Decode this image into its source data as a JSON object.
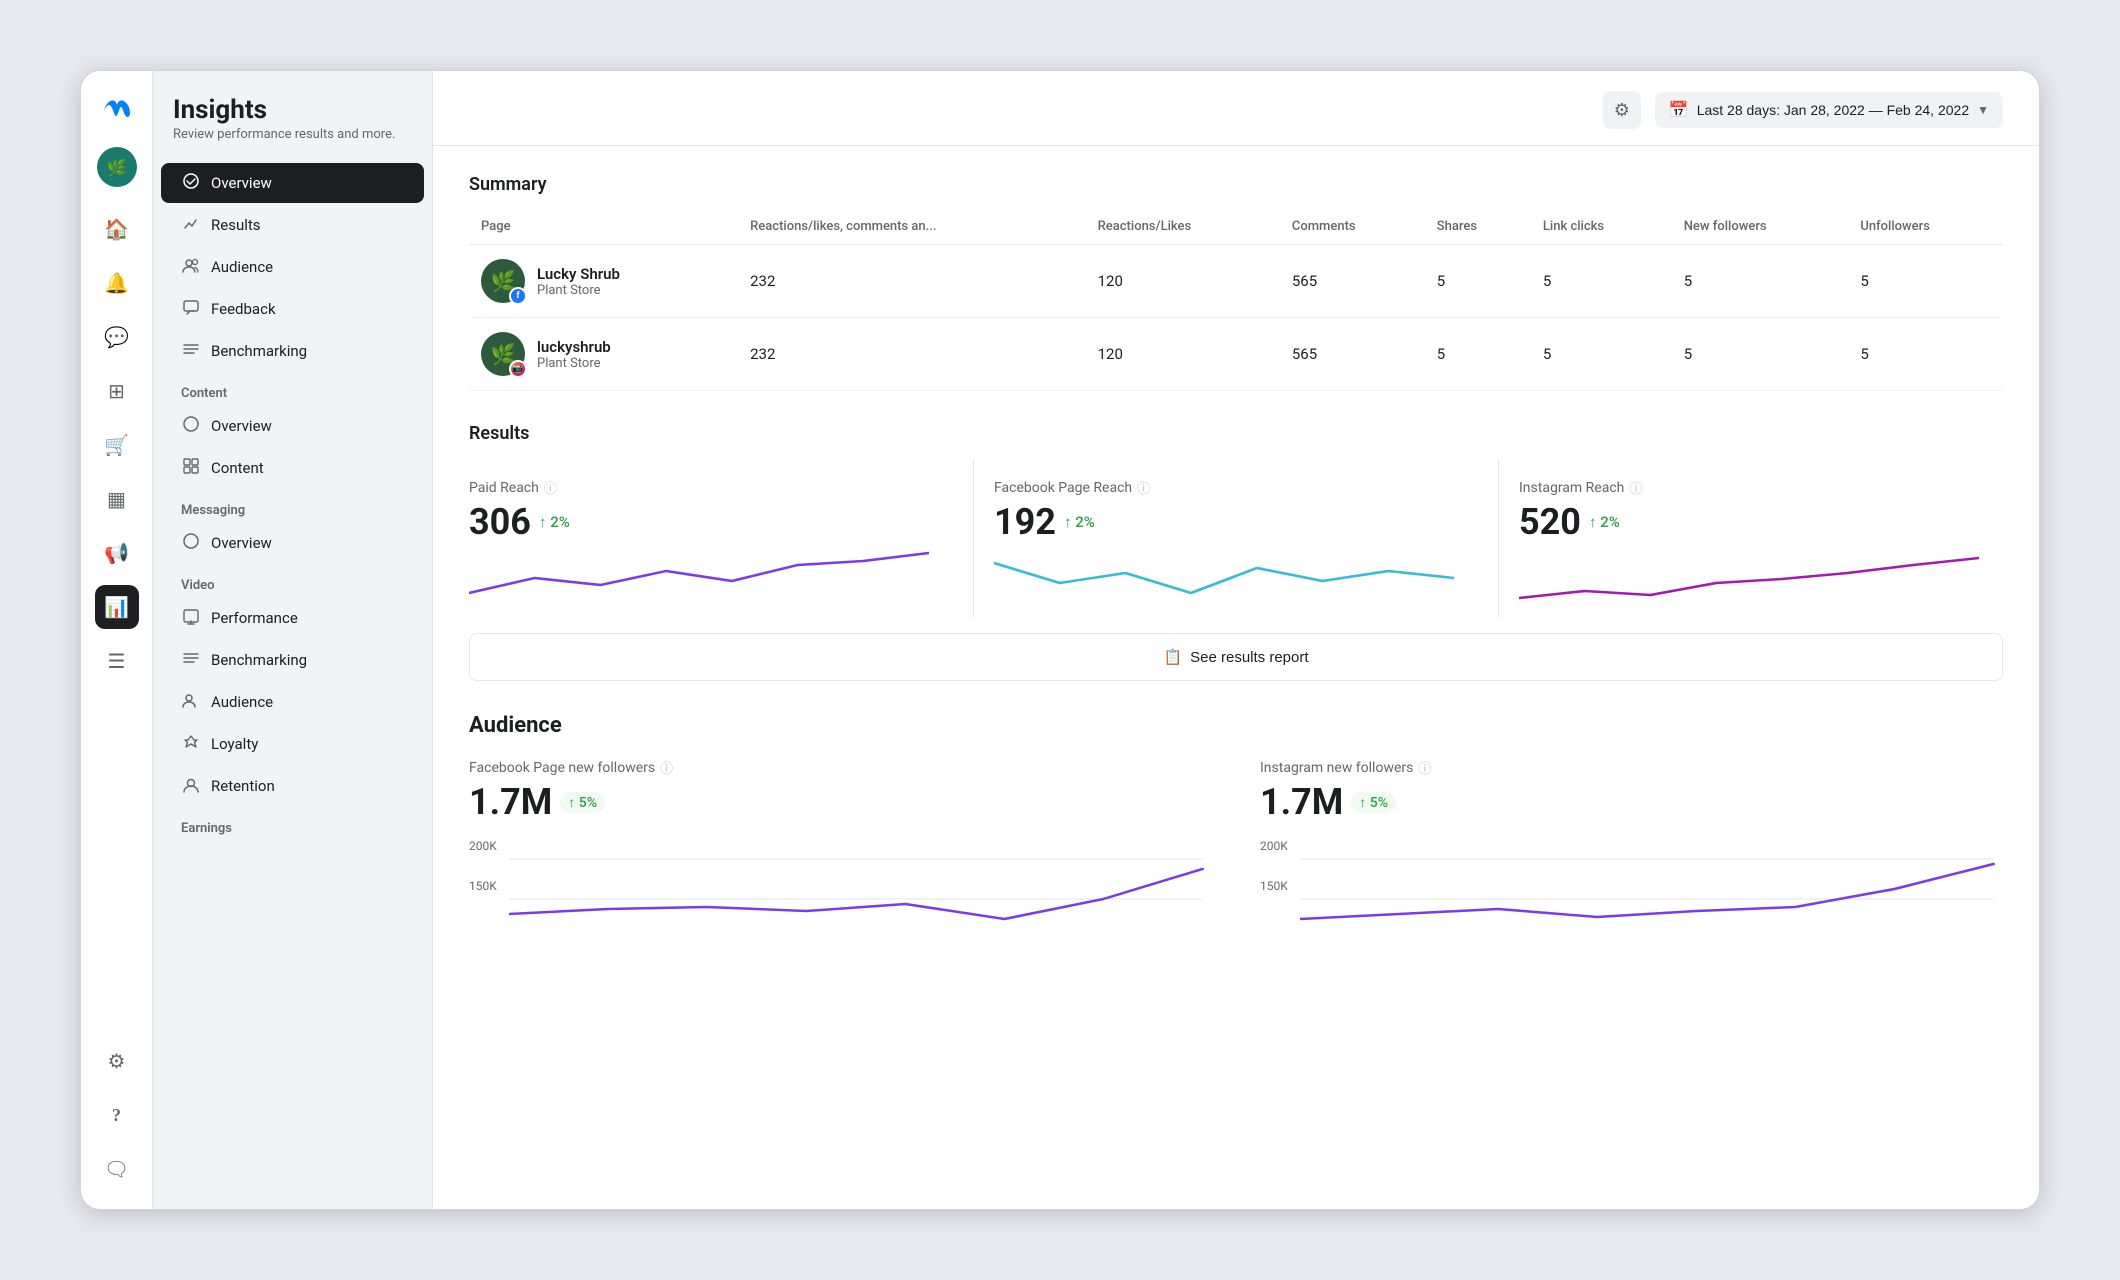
{
  "app": {
    "title": "Insights",
    "subtitle": "Review performance results and more."
  },
  "header": {
    "date_range": "Last 28 days: Jan 28, 2022 — Feb 24, 2022",
    "gear_icon": "⚙",
    "calendar_icon": "📅"
  },
  "sidebar": {
    "top_nav": [
      {
        "label": "Overview",
        "icon": "◈",
        "active": true
      },
      {
        "label": "Results",
        "icon": "↗"
      },
      {
        "label": "Audience",
        "icon": "👥"
      },
      {
        "label": "Feedback",
        "icon": "💬"
      },
      {
        "label": "Benchmarking",
        "icon": "≋"
      }
    ],
    "sections": [
      {
        "label": "Content",
        "items": [
          {
            "label": "Overview",
            "icon": "◈"
          },
          {
            "label": "Content",
            "icon": "▦"
          }
        ]
      },
      {
        "label": "Messaging",
        "items": [
          {
            "label": "Overview",
            "icon": "◈"
          }
        ]
      },
      {
        "label": "Video",
        "items": [
          {
            "label": "Performance",
            "icon": "▣"
          },
          {
            "label": "Benchmarking",
            "icon": "≋"
          },
          {
            "label": "Audience",
            "icon": "👥"
          },
          {
            "label": "Loyalty",
            "icon": "🛡"
          },
          {
            "label": "Retention",
            "icon": "👤"
          }
        ]
      },
      {
        "label": "Earnings",
        "items": []
      }
    ]
  },
  "summary": {
    "title": "Summary",
    "columns": [
      "Page",
      "Reactions/likes, comments an...",
      "Reactions/Likes",
      "Comments",
      "Shares",
      "Link clicks",
      "New followers",
      "Unfollowers"
    ],
    "rows": [
      {
        "name": "Lucky Shrub",
        "type": "Plant Store",
        "platform": "facebook",
        "reactions_all": "232",
        "reactions_likes": "120",
        "comments": "565",
        "shares": "5",
        "link_clicks": "5",
        "new_followers": "5",
        "unfollowers": "5"
      },
      {
        "name": "luckyshrub",
        "type": "Plant Store",
        "platform": "instagram",
        "reactions_all": "232",
        "reactions_likes": "120",
        "comments": "565",
        "shares": "5",
        "link_clicks": "5",
        "new_followers": "5",
        "unfollowers": "5"
      }
    ]
  },
  "results": {
    "title": "Results",
    "cards": [
      {
        "label": "Paid Reach",
        "value": "306",
        "change": "↑ 2%",
        "chart_color": "#7c3aed",
        "chart_id": "paid"
      },
      {
        "label": "Facebook Page Reach",
        "value": "192",
        "change": "↑ 2%",
        "chart_color": "#38bcd4",
        "chart_id": "fb"
      },
      {
        "label": "Instagram Reach",
        "value": "520",
        "change": "↑ 2%",
        "chart_color": "#a21caf",
        "chart_id": "ig"
      }
    ],
    "see_report_label": "See results report"
  },
  "audience": {
    "title": "Audience",
    "cards": [
      {
        "label": "Facebook Page new followers",
        "value": "1.7M",
        "change": "↑ 5%",
        "chart_color": "#7c3aed",
        "y_labels": [
          "200K",
          "150K"
        ]
      },
      {
        "label": "Instagram new followers",
        "value": "1.7M",
        "change": "↑ 5%",
        "chart_color": "#7c3aed",
        "y_labels": [
          "200K",
          "150K"
        ]
      }
    ]
  },
  "iconbar": {
    "icons": [
      {
        "name": "home-icon",
        "glyph": "🏠"
      },
      {
        "name": "bell-icon",
        "glyph": "🔔"
      },
      {
        "name": "message-icon",
        "glyph": "💬"
      },
      {
        "name": "layers-icon",
        "glyph": "▦"
      },
      {
        "name": "cart-icon",
        "glyph": "🛒"
      },
      {
        "name": "table-icon",
        "glyph": "⊞"
      },
      {
        "name": "megaphone-icon",
        "glyph": "📢"
      },
      {
        "name": "chart-icon",
        "glyph": "📊"
      },
      {
        "name": "menu-icon",
        "glyph": "☰"
      }
    ],
    "bottom_icons": [
      {
        "name": "settings-icon",
        "glyph": "⚙"
      },
      {
        "name": "help-icon",
        "glyph": "?"
      },
      {
        "name": "feedback-icon",
        "glyph": "💬"
      }
    ]
  }
}
